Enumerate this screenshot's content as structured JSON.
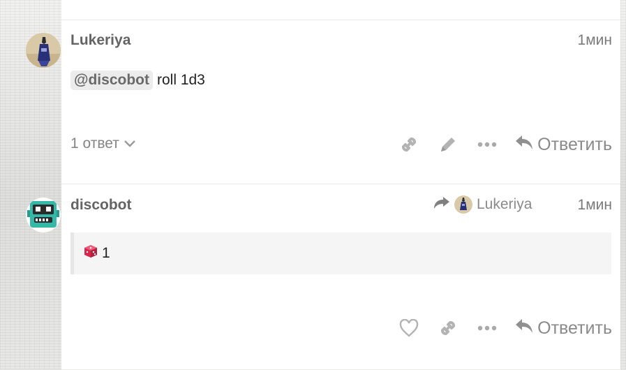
{
  "posts": [
    {
      "username": "Lukeriya",
      "time": "1мин",
      "mention": "@discobot",
      "text": "roll 1d3",
      "replies_label": "1 ответ",
      "reply_label": "Ответить"
    },
    {
      "username": "discobot",
      "time": "1мин",
      "reply_to_user": "Lukeriya",
      "result": "1",
      "reply_label": "Ответить"
    }
  ],
  "colors": {
    "username": "#646464",
    "muted": "#8a8a8a",
    "mention_bg": "#ececec",
    "bot_teal": "#34b8a8",
    "dice_red": "#d6264a"
  },
  "icons": [
    "link-icon",
    "pencil-icon",
    "more-icon",
    "reply-icon",
    "heart-icon",
    "chevron-down-icon",
    "dice-icon",
    "share-arrow-icon"
  ]
}
